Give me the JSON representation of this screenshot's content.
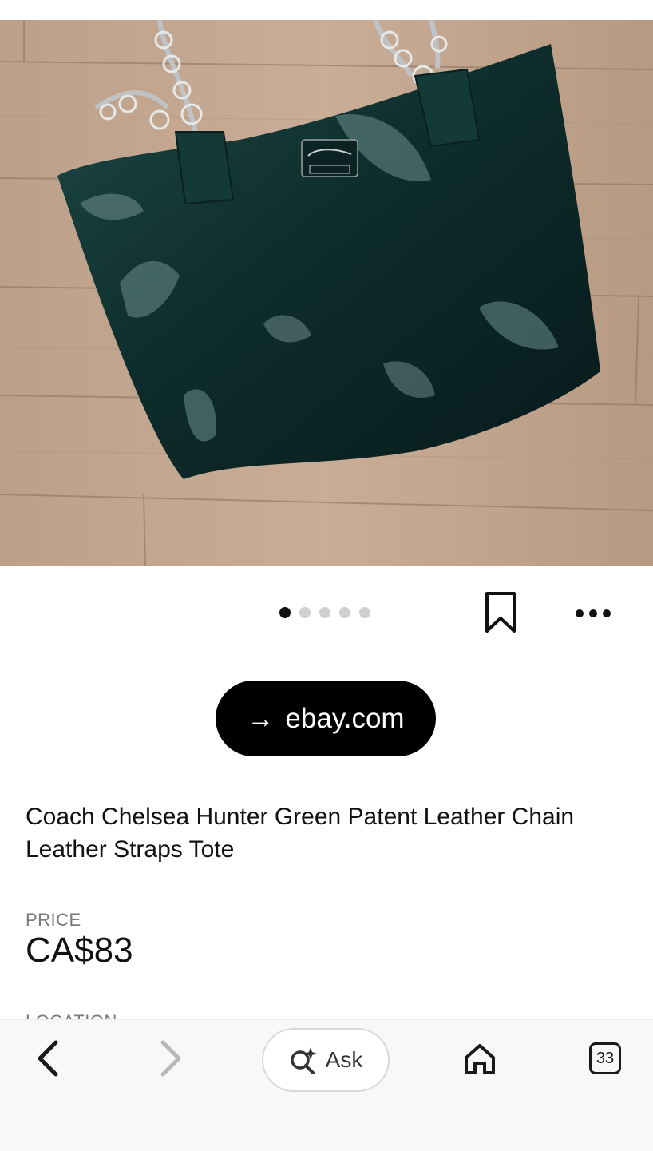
{
  "hero": {
    "alt": "product-photo",
    "dots_total": 5,
    "active_dot": 0
  },
  "actions": {
    "save_icon": "bookmark-icon",
    "more_icon": "more-horizontal-icon"
  },
  "link": {
    "arrow": "→",
    "label": "ebay.com"
  },
  "product": {
    "title": "Coach Chelsea Hunter Green Patent Leather Chain Leather Straps Tote",
    "price_label": "PRICE",
    "price": "CA$83",
    "next_label_cut": "LOCATION"
  },
  "bottom_bar": {
    "back_icon": "chevron-left-icon",
    "forward_icon": "chevron-right-icon",
    "ask_label": "Ask",
    "ask_icon": "search-sparkle-icon",
    "home_icon": "home-icon",
    "tabs_count": "33"
  },
  "colors": {
    "pill_bg": "#000000",
    "active_dot": "#111111",
    "inactive_dot": "#cfcfcf",
    "forward_disabled": "#b8b8b8"
  }
}
